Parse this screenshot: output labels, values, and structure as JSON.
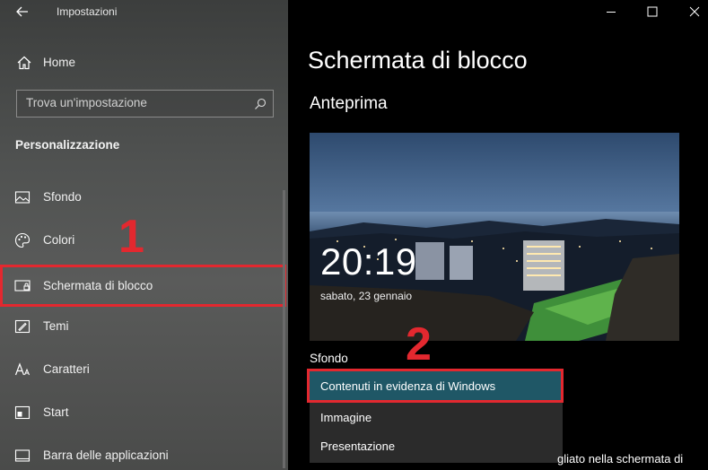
{
  "window": {
    "title": "Impostazioni"
  },
  "sidebar": {
    "home_label": "Home",
    "search": {
      "placeholder": "Trova un'impostazione"
    },
    "section_title": "Personalizzazione",
    "items": [
      {
        "label": "Sfondo",
        "icon": "picture-icon",
        "selected": false
      },
      {
        "label": "Colori",
        "icon": "palette-icon",
        "selected": false
      },
      {
        "label": "Schermata di blocco",
        "icon": "lock-screen-icon",
        "selected": true
      },
      {
        "label": "Temi",
        "icon": "themes-icon",
        "selected": false
      },
      {
        "label": "Caratteri",
        "icon": "fonts-icon",
        "selected": false
      },
      {
        "label": "Start",
        "icon": "start-icon",
        "selected": false
      },
      {
        "label": "Barra delle applicazioni",
        "icon": "taskbar-icon",
        "selected": false
      }
    ]
  },
  "annotations": {
    "step1": "1",
    "step2": "2",
    "color": "#e3282f"
  },
  "main": {
    "page_title": "Schermata di blocco",
    "preview_heading": "Anteprima",
    "preview": {
      "time": "20:19",
      "date": "sabato, 23 gennaio"
    },
    "background_label": "Sfondo",
    "background_options": [
      {
        "label": "Contenuti in evidenza di Windows",
        "selected": true
      },
      {
        "label": "Immagine",
        "selected": false
      },
      {
        "label": "Presentazione",
        "selected": false
      }
    ],
    "trailing_text": "gliato nella schermata di"
  },
  "colors": {
    "accent_selected": "#1f5766",
    "highlight_border": "#e3282f"
  }
}
